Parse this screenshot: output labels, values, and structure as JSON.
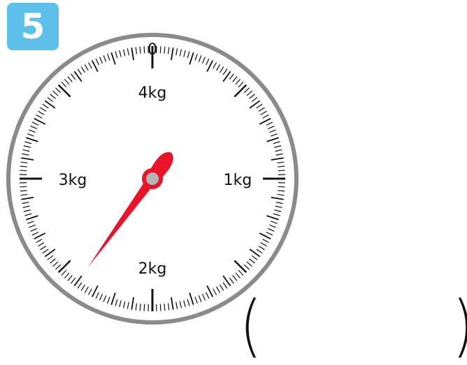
{
  "problem": {
    "number": "5"
  },
  "scale": {
    "labels": {
      "top_zero": "0",
      "top_inner": "4kg",
      "right": "1kg",
      "bottom": "2kg",
      "left": "3kg"
    },
    "max_kg": 4,
    "needle_reading_kg": 2.4,
    "needle_color": "#e8142a",
    "rim_color": "#8a8a8a",
    "hub_color": "#b5b5b5"
  },
  "answer": {
    "open_paren": "(",
    "close_paren": ")",
    "value": ""
  },
  "colors": {
    "badge": "#5cc0e8"
  }
}
